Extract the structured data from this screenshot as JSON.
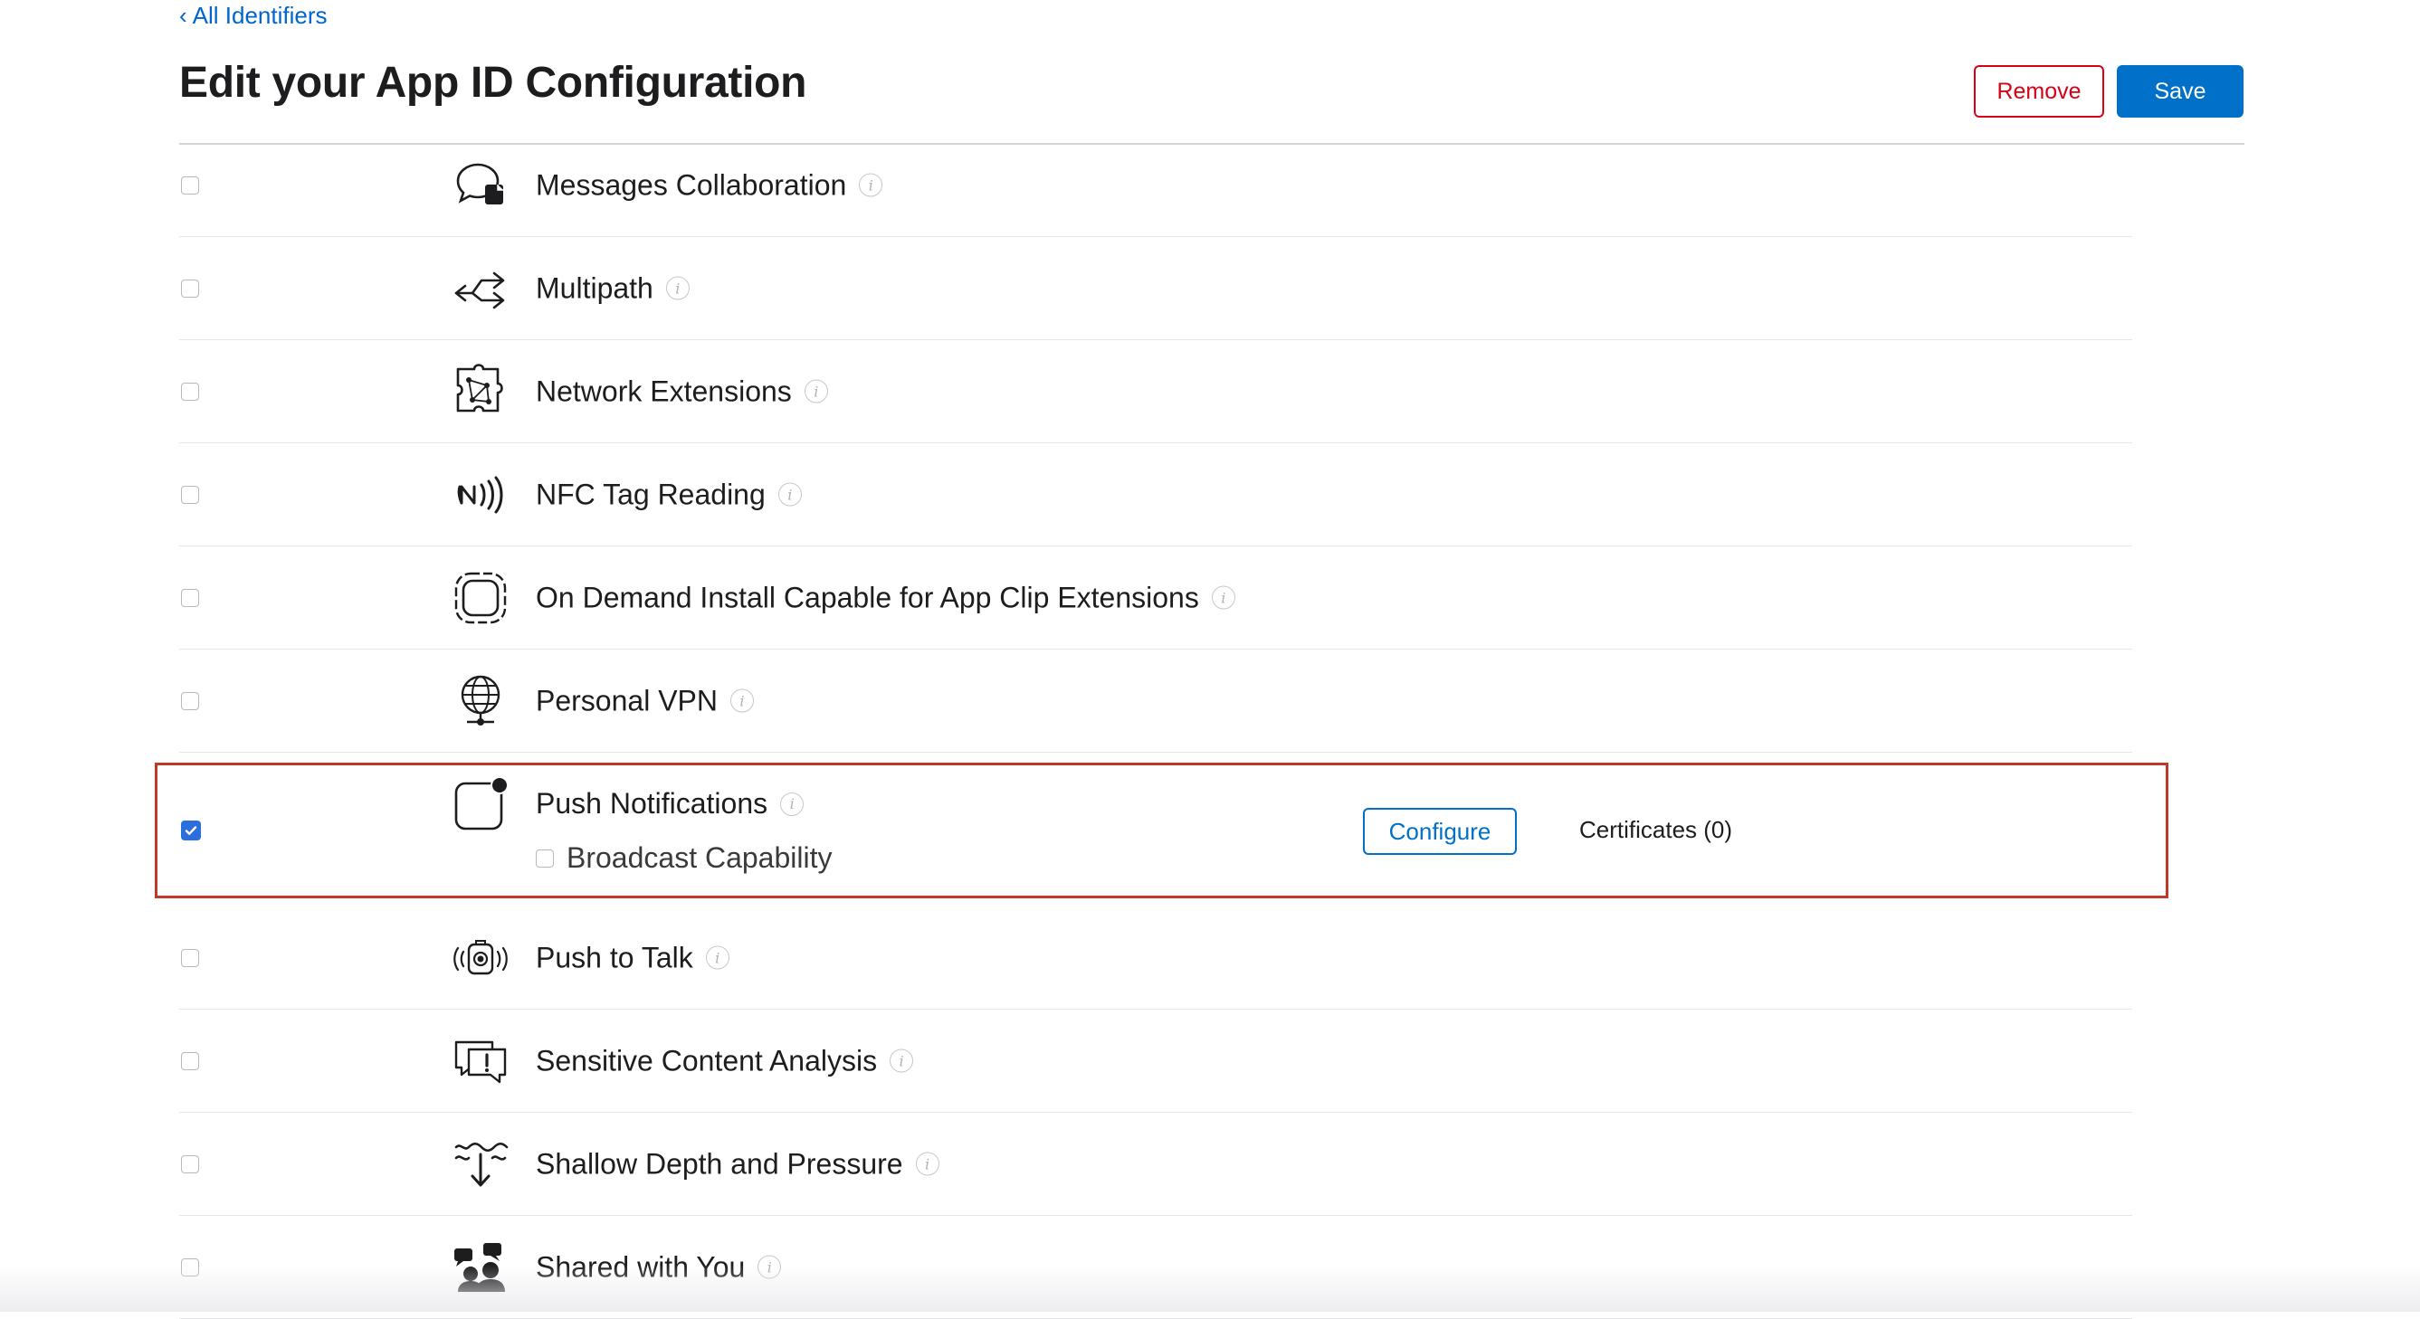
{
  "nav": {
    "back_label": "All Identifiers"
  },
  "page": {
    "title": "Edit your App ID Configuration"
  },
  "actions": {
    "remove_label": "Remove",
    "save_label": "Save"
  },
  "capabilities": [
    {
      "label": "Messages Collaboration",
      "checked": false,
      "icon": "messages-collaboration-icon"
    },
    {
      "label": "Multipath",
      "checked": false,
      "icon": "multipath-icon"
    },
    {
      "label": "Network Extensions",
      "checked": false,
      "icon": "network-extensions-icon"
    },
    {
      "label": "NFC Tag Reading",
      "checked": false,
      "icon": "nfc-icon"
    },
    {
      "label": "On Demand Install Capable for App Clip Extensions",
      "checked": false,
      "icon": "app-clip-icon"
    },
    {
      "label": "Personal VPN",
      "checked": false,
      "icon": "globe-vpn-icon"
    },
    {
      "label": "Push Notifications",
      "checked": true,
      "icon": "push-notification-icon",
      "sub_option": {
        "label": "Broadcast Capability",
        "checked": false
      },
      "configure_label": "Configure",
      "certificates_label": "Certificates (0)"
    },
    {
      "label": "Push to Talk",
      "checked": false,
      "icon": "push-to-talk-icon"
    },
    {
      "label": "Sensitive Content Analysis",
      "checked": false,
      "icon": "sensitive-content-icon"
    },
    {
      "label": "Shallow Depth and Pressure",
      "checked": false,
      "icon": "depth-pressure-icon"
    },
    {
      "label": "Shared with You",
      "checked": false,
      "icon": "shared-with-you-icon"
    }
  ],
  "colors": {
    "accent": "#0070c9",
    "danger": "#d70015",
    "highlight_frame": "#c0392b"
  }
}
